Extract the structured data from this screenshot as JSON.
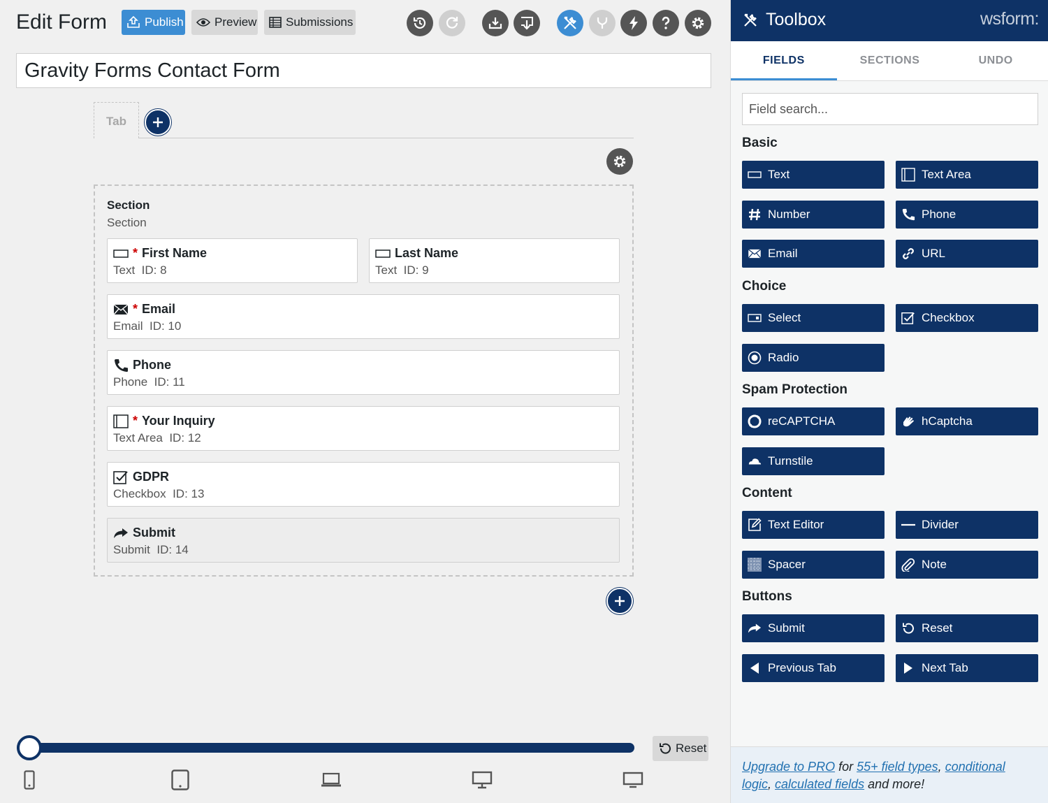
{
  "header": {
    "title": "Edit Form",
    "publish_label": "Publish",
    "preview_label": "Preview",
    "submissions_label": "Submissions",
    "icons": [
      "history-icon",
      "redo-icon",
      "import-icon",
      "download-icon",
      "tools-icon",
      "branch-icon",
      "bolt-icon",
      "help-icon",
      "gear-icon"
    ]
  },
  "form": {
    "name": "Gravity Forms Contact Form",
    "tab_label": "Tab",
    "section": {
      "title": "Section",
      "subtitle": "Section",
      "fields": [
        {
          "label": "First Name",
          "type": "Text",
          "id": "ID: 8",
          "required": true,
          "icon": "text-field-icon"
        },
        {
          "label": "Last Name",
          "type": "Text",
          "id": "ID: 9",
          "required": false,
          "icon": "text-field-icon"
        },
        {
          "label": "Email",
          "type": "Email",
          "id": "ID: 10",
          "required": true,
          "icon": "email-icon"
        },
        {
          "label": "Phone",
          "type": "Phone",
          "id": "ID: 11",
          "required": false,
          "icon": "phone-icon"
        },
        {
          "label": "Your Inquiry",
          "type": "Text Area",
          "id": "ID: 12",
          "required": true,
          "icon": "textarea-icon"
        },
        {
          "label": "GDPR",
          "type": "Checkbox",
          "id": "ID: 13",
          "required": false,
          "icon": "checkbox-icon"
        },
        {
          "label": "Submit",
          "type": "Submit",
          "id": "ID: 14",
          "required": false,
          "icon": "submit-arrow-icon"
        }
      ]
    }
  },
  "breakpoint": {
    "reset_label": "Reset",
    "slider_level": 0,
    "devices": [
      "mobile-icon",
      "tablet-icon",
      "laptop-icon",
      "desktop-icon",
      "large-desktop-icon"
    ]
  },
  "toolbox": {
    "title": "Toolbox",
    "logo": "wsform:",
    "tabs": [
      "FIELDS",
      "SECTIONS",
      "UNDO"
    ],
    "active_tab": "FIELDS",
    "search_placeholder": "Field search...",
    "groups": {
      "basic": {
        "label": "Basic",
        "items": [
          "Text",
          "Text Area",
          "Number",
          "Phone",
          "Email",
          "URL"
        ]
      },
      "choice": {
        "label": "Choice",
        "items": [
          "Select",
          "Checkbox",
          "Radio"
        ]
      },
      "spam": {
        "label": "Spam Protection",
        "items": [
          "reCAPTCHA",
          "hCaptcha",
          "Turnstile"
        ]
      },
      "content": {
        "label": "Content",
        "items": [
          "Text Editor",
          "Divider",
          "Spacer",
          "Note"
        ]
      },
      "buttons": {
        "label": "Buttons",
        "items": [
          "Submit",
          "Reset",
          "Previous Tab",
          "Next Tab"
        ]
      }
    },
    "footer": {
      "upgrade_link": "Upgrade to PRO",
      "for_text": " for ",
      "field_types_link": "55+ field types",
      "comma1": ", ",
      "conditional_link": "conditional logic",
      "comma2": ", ",
      "calculated_link": "calculated fields",
      "tail_text": " and more!"
    }
  },
  "colors": {
    "primary_navy": "#0e3266",
    "accent_blue": "#3c8dd3",
    "required_red": "#cc0000",
    "icon_gray": "#555555"
  }
}
